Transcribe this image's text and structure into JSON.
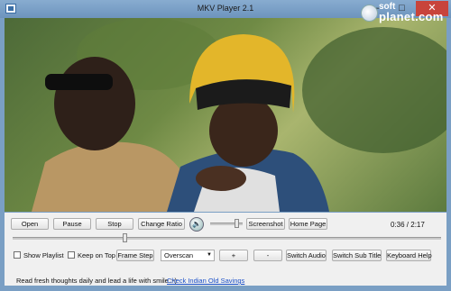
{
  "window": {
    "title": "MKV Player 2.1",
    "minimize": "–",
    "maximize": "□",
    "close": "✕"
  },
  "watermark": {
    "soft": "soft",
    "planet": "planet.com"
  },
  "icons": {
    "app": "app-icon",
    "volume": "speaker-icon",
    "dropdown": "chevron-down-icon"
  },
  "toolbar": {
    "open": "Open",
    "pause": "Pause",
    "stop": "Stop",
    "change_ratio": "Change Ratio",
    "screenshot": "Screenshot",
    "home_page": "Home Page",
    "time": "0:36 / 2:17",
    "volume_level": 0.8,
    "seek_progress": 0.26
  },
  "options": {
    "show_playlist": "Show Playlist",
    "keep_on_top": "Keep on Top",
    "frame_step": "Frame Step",
    "scan_mode": "Overscan",
    "plus": "+",
    "minus": "-",
    "switch_audio": "Switch Audio",
    "switch_subtitle": "Switch Sub Title",
    "keyboard_help": "Keyboard Help"
  },
  "status": {
    "message": "Read fresh thoughts daily and lead a life with smile :-)",
    "link": "Check Indian Old Savings"
  }
}
